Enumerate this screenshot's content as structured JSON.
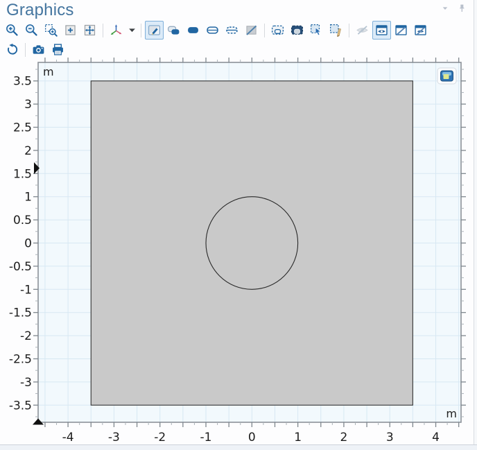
{
  "header": {
    "title": "Graphics"
  },
  "toolbar": {
    "row1": [
      {
        "name": "zoom-in-button",
        "icon": "zoom-in-icon"
      },
      {
        "name": "zoom-out-button",
        "icon": "zoom-out-icon"
      },
      {
        "name": "zoom-box-button",
        "icon": "zoom-box-icon"
      },
      {
        "name": "zoom-selected-button",
        "icon": "zoom-selected-icon"
      },
      {
        "name": "zoom-extents-button",
        "icon": "zoom-extents-icon"
      },
      {
        "sep": true
      },
      {
        "name": "go-to-default-view-button",
        "icon": "go-to-view-icon"
      },
      {
        "name": "view-menu-caret-button",
        "icon": "caret-down-icon",
        "narrow": true
      },
      {
        "sep": true
      },
      {
        "name": "select-button",
        "icon": "select-icon",
        "selected": true
      },
      {
        "name": "select-multiple-button",
        "icon": "select-multiple-icon"
      },
      {
        "name": "select-domains-button",
        "icon": "select-domains-icon"
      },
      {
        "name": "select-boundaries-button",
        "icon": "select-boundaries-icon"
      },
      {
        "name": "select-edges-button",
        "icon": "select-edges-icon"
      },
      {
        "name": "deselect-all-button",
        "icon": "select-none-icon"
      },
      {
        "sep": true
      },
      {
        "name": "box-select-button",
        "icon": "box-select-icon"
      },
      {
        "name": "box-deselect-button",
        "icon": "box-deselect-icon"
      },
      {
        "name": "select-entities-button",
        "icon": "select-entities-icon"
      },
      {
        "name": "paint-select-button",
        "icon": "paint-select-icon"
      },
      {
        "sep": true
      },
      {
        "name": "hide-selected-button",
        "icon": "hide-disabled-icon",
        "disabled": true
      },
      {
        "name": "view-hidden-button",
        "icon": "view-hidden-icon",
        "selected": true
      },
      {
        "name": "reset-hiding-button",
        "icon": "reset-hiding-icon"
      },
      {
        "name": "show-hidden-button",
        "icon": "show-hidden-icon"
      }
    ],
    "row2": [
      {
        "name": "reset-current-view-button",
        "icon": "reset-view-icon"
      },
      {
        "sep": true
      },
      {
        "name": "image-snapshot-button",
        "icon": "snapshot-icon"
      },
      {
        "name": "print-button",
        "icon": "print-icon"
      }
    ]
  },
  "plot": {
    "unit_label": "m",
    "view": {
      "x_min": -4.65,
      "x_max": 4.55,
      "y_min": -3.87,
      "y_max": 3.9
    },
    "x_axis": {
      "tick_values": [
        -4,
        -3,
        -2,
        -1,
        0,
        1,
        2,
        3,
        4
      ],
      "tick_labels": [
        "-4",
        "-3",
        "-2",
        "-1",
        "0",
        "1",
        "2",
        "3",
        "4"
      ],
      "minor_step": 0.25,
      "major_step": 0.5
    },
    "y_axis": {
      "tick_values": [
        3.5,
        3,
        2.5,
        2,
        1.5,
        1,
        0.5,
        0,
        -0.5,
        -1,
        -1.5,
        -2,
        -2.5,
        -3,
        -3.5
      ],
      "tick_labels": [
        "3.5",
        "3",
        "2.5",
        "2",
        "1.5",
        "1",
        "0.5",
        "0",
        "-0.5",
        "-1",
        "-1.5",
        "-2",
        "-2.5",
        "-3",
        "-3.5"
      ],
      "minor_step": 0.25,
      "major_step": 0.5
    },
    "grid_step": 0.5,
    "geometry": {
      "square": {
        "x_min": -3.5,
        "x_max": 3.5,
        "y_min": -3.5,
        "y_max": 3.5
      },
      "circle": {
        "cx": 0,
        "cy": 0,
        "r": 1
      }
    }
  },
  "colors": {
    "accent_blue": "#2166a2",
    "title_blue": "#44759f",
    "plot_background": "#f2f9fd",
    "grid_line": "#d7e8f3",
    "plot_border": "#8b9198",
    "square_fill": "#c9c9c9",
    "geometry_stroke": "#333333",
    "selected_button_bg": "#dcebf8",
    "selected_button_border": "#7fb0da"
  }
}
